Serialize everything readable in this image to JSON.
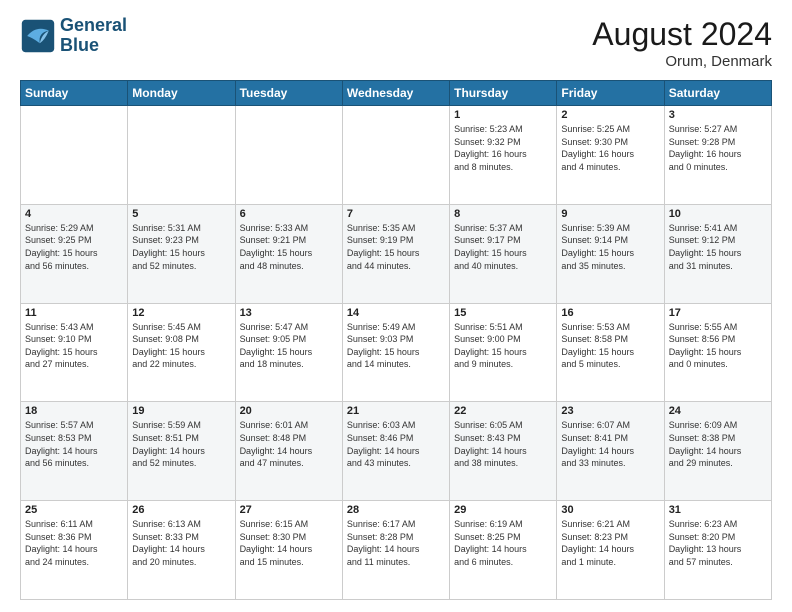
{
  "header": {
    "logo_line1": "General",
    "logo_line2": "Blue",
    "month": "August 2024",
    "location": "Orum, Denmark"
  },
  "weekdays": [
    "Sunday",
    "Monday",
    "Tuesday",
    "Wednesday",
    "Thursday",
    "Friday",
    "Saturday"
  ],
  "weeks": [
    [
      {
        "day": "",
        "info": ""
      },
      {
        "day": "",
        "info": ""
      },
      {
        "day": "",
        "info": ""
      },
      {
        "day": "",
        "info": ""
      },
      {
        "day": "1",
        "info": "Sunrise: 5:23 AM\nSunset: 9:32 PM\nDaylight: 16 hours\nand 8 minutes."
      },
      {
        "day": "2",
        "info": "Sunrise: 5:25 AM\nSunset: 9:30 PM\nDaylight: 16 hours\nand 4 minutes."
      },
      {
        "day": "3",
        "info": "Sunrise: 5:27 AM\nSunset: 9:28 PM\nDaylight: 16 hours\nand 0 minutes."
      }
    ],
    [
      {
        "day": "4",
        "info": "Sunrise: 5:29 AM\nSunset: 9:25 PM\nDaylight: 15 hours\nand 56 minutes."
      },
      {
        "day": "5",
        "info": "Sunrise: 5:31 AM\nSunset: 9:23 PM\nDaylight: 15 hours\nand 52 minutes."
      },
      {
        "day": "6",
        "info": "Sunrise: 5:33 AM\nSunset: 9:21 PM\nDaylight: 15 hours\nand 48 minutes."
      },
      {
        "day": "7",
        "info": "Sunrise: 5:35 AM\nSunset: 9:19 PM\nDaylight: 15 hours\nand 44 minutes."
      },
      {
        "day": "8",
        "info": "Sunrise: 5:37 AM\nSunset: 9:17 PM\nDaylight: 15 hours\nand 40 minutes."
      },
      {
        "day": "9",
        "info": "Sunrise: 5:39 AM\nSunset: 9:14 PM\nDaylight: 15 hours\nand 35 minutes."
      },
      {
        "day": "10",
        "info": "Sunrise: 5:41 AM\nSunset: 9:12 PM\nDaylight: 15 hours\nand 31 minutes."
      }
    ],
    [
      {
        "day": "11",
        "info": "Sunrise: 5:43 AM\nSunset: 9:10 PM\nDaylight: 15 hours\nand 27 minutes."
      },
      {
        "day": "12",
        "info": "Sunrise: 5:45 AM\nSunset: 9:08 PM\nDaylight: 15 hours\nand 22 minutes."
      },
      {
        "day": "13",
        "info": "Sunrise: 5:47 AM\nSunset: 9:05 PM\nDaylight: 15 hours\nand 18 minutes."
      },
      {
        "day": "14",
        "info": "Sunrise: 5:49 AM\nSunset: 9:03 PM\nDaylight: 15 hours\nand 14 minutes."
      },
      {
        "day": "15",
        "info": "Sunrise: 5:51 AM\nSunset: 9:00 PM\nDaylight: 15 hours\nand 9 minutes."
      },
      {
        "day": "16",
        "info": "Sunrise: 5:53 AM\nSunset: 8:58 PM\nDaylight: 15 hours\nand 5 minutes."
      },
      {
        "day": "17",
        "info": "Sunrise: 5:55 AM\nSunset: 8:56 PM\nDaylight: 15 hours\nand 0 minutes."
      }
    ],
    [
      {
        "day": "18",
        "info": "Sunrise: 5:57 AM\nSunset: 8:53 PM\nDaylight: 14 hours\nand 56 minutes."
      },
      {
        "day": "19",
        "info": "Sunrise: 5:59 AM\nSunset: 8:51 PM\nDaylight: 14 hours\nand 52 minutes."
      },
      {
        "day": "20",
        "info": "Sunrise: 6:01 AM\nSunset: 8:48 PM\nDaylight: 14 hours\nand 47 minutes."
      },
      {
        "day": "21",
        "info": "Sunrise: 6:03 AM\nSunset: 8:46 PM\nDaylight: 14 hours\nand 43 minutes."
      },
      {
        "day": "22",
        "info": "Sunrise: 6:05 AM\nSunset: 8:43 PM\nDaylight: 14 hours\nand 38 minutes."
      },
      {
        "day": "23",
        "info": "Sunrise: 6:07 AM\nSunset: 8:41 PM\nDaylight: 14 hours\nand 33 minutes."
      },
      {
        "day": "24",
        "info": "Sunrise: 6:09 AM\nSunset: 8:38 PM\nDaylight: 14 hours\nand 29 minutes."
      }
    ],
    [
      {
        "day": "25",
        "info": "Sunrise: 6:11 AM\nSunset: 8:36 PM\nDaylight: 14 hours\nand 24 minutes."
      },
      {
        "day": "26",
        "info": "Sunrise: 6:13 AM\nSunset: 8:33 PM\nDaylight: 14 hours\nand 20 minutes."
      },
      {
        "day": "27",
        "info": "Sunrise: 6:15 AM\nSunset: 8:30 PM\nDaylight: 14 hours\nand 15 minutes."
      },
      {
        "day": "28",
        "info": "Sunrise: 6:17 AM\nSunset: 8:28 PM\nDaylight: 14 hours\nand 11 minutes."
      },
      {
        "day": "29",
        "info": "Sunrise: 6:19 AM\nSunset: 8:25 PM\nDaylight: 14 hours\nand 6 minutes."
      },
      {
        "day": "30",
        "info": "Sunrise: 6:21 AM\nSunset: 8:23 PM\nDaylight: 14 hours\nand 1 minute."
      },
      {
        "day": "31",
        "info": "Sunrise: 6:23 AM\nSunset: 8:20 PM\nDaylight: 13 hours\nand 57 minutes."
      }
    ]
  ]
}
